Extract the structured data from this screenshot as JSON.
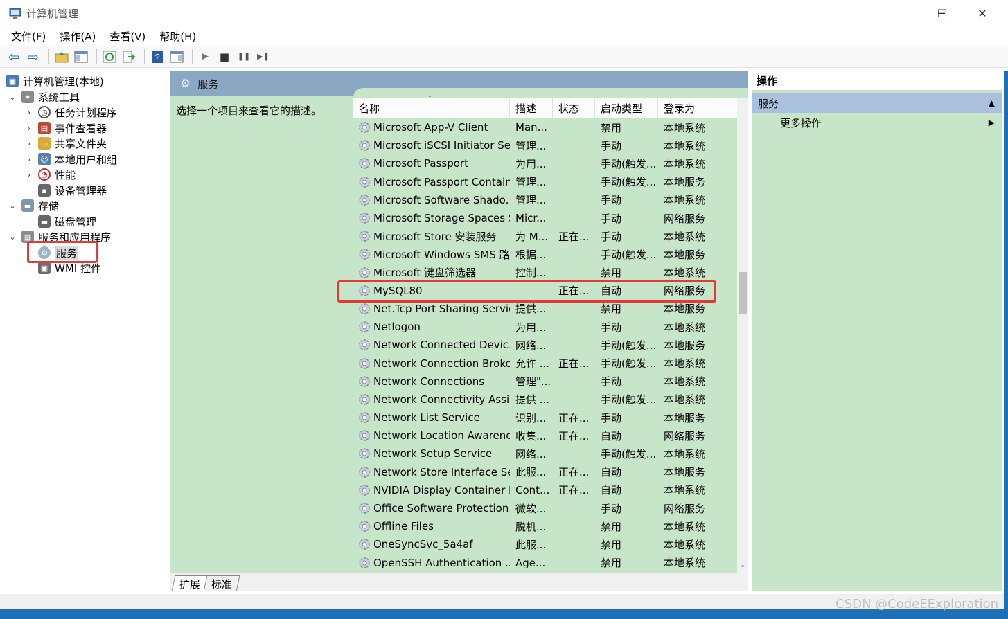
{
  "window": {
    "title": "计算机管理",
    "minimize": "─",
    "maximize": "☐",
    "close": "✕"
  },
  "menu": [
    "文件(F)",
    "操作(A)",
    "查看(V)",
    "帮助(H)"
  ],
  "toolbar": {
    "back": "⇦",
    "forward": "⇨",
    "play": "▶",
    "stop": "■",
    "pause": "❚❚",
    "restart": "▶❚"
  },
  "tree": {
    "root": "计算机管理(本地)",
    "system_tools": "系统工具",
    "task_scheduler": "任务计划程序",
    "event_viewer": "事件查看器",
    "shared_folders": "共享文件夹",
    "local_users": "本地用户和组",
    "performance": "性能",
    "device_manager": "设备管理器",
    "storage": "存储",
    "disk_management": "磁盘管理",
    "services_apps": "服务和应用程序",
    "services": "服务",
    "wmi": "WMI 控件"
  },
  "center": {
    "header": "服务",
    "description": "选择一个项目来查看它的描述。",
    "columns": [
      "名称",
      "描述",
      "状态",
      "启动类型",
      "登录为"
    ],
    "rows": [
      {
        "name": "Microsoft App-V Client",
        "desc": "Man...",
        "status": "",
        "startup": "禁用",
        "logon": "本地系统"
      },
      {
        "name": "Microsoft iSCSI Initiator Ser...",
        "desc": "管理...",
        "status": "",
        "startup": "手动",
        "logon": "本地系统"
      },
      {
        "name": "Microsoft Passport",
        "desc": "为用...",
        "status": "",
        "startup": "手动(触发...",
        "logon": "本地系统"
      },
      {
        "name": "Microsoft Passport Container",
        "desc": "管理...",
        "status": "",
        "startup": "手动(触发...",
        "logon": "本地服务"
      },
      {
        "name": "Microsoft Software Shado...",
        "desc": "管理...",
        "status": "",
        "startup": "手动",
        "logon": "本地系统"
      },
      {
        "name": "Microsoft Storage Spaces S...",
        "desc": "Micr...",
        "status": "",
        "startup": "手动",
        "logon": "网络服务"
      },
      {
        "name": "Microsoft Store 安装服务",
        "desc": "为 M...",
        "status": "正在...",
        "startup": "手动",
        "logon": "本地系统"
      },
      {
        "name": "Microsoft Windows SMS 路...",
        "desc": "根据...",
        "status": "",
        "startup": "手动(触发...",
        "logon": "本地服务"
      },
      {
        "name": "Microsoft 键盘筛选器",
        "desc": "控制...",
        "status": "",
        "startup": "禁用",
        "logon": "本地系统"
      },
      {
        "name": "MySQL80",
        "desc": "",
        "status": "正在...",
        "startup": "自动",
        "logon": "网络服务"
      },
      {
        "name": "Net.Tcp Port Sharing Service",
        "desc": "提供...",
        "status": "",
        "startup": "禁用",
        "logon": "本地服务"
      },
      {
        "name": "Netlogon",
        "desc": "为用...",
        "status": "",
        "startup": "手动",
        "logon": "本地系统"
      },
      {
        "name": "Network Connected Devic...",
        "desc": "网络...",
        "status": "",
        "startup": "手动(触发...",
        "logon": "本地服务"
      },
      {
        "name": "Network Connection Broker",
        "desc": "允许 ...",
        "status": "正在...",
        "startup": "手动(触发...",
        "logon": "本地系统"
      },
      {
        "name": "Network Connections",
        "desc": "管理\"...",
        "status": "",
        "startup": "手动",
        "logon": "本地系统"
      },
      {
        "name": "Network Connectivity Assis...",
        "desc": "提供 ...",
        "status": "",
        "startup": "手动(触发...",
        "logon": "本地系统"
      },
      {
        "name": "Network List Service",
        "desc": "识别...",
        "status": "正在...",
        "startup": "手动",
        "logon": "本地服务"
      },
      {
        "name": "Network Location Awarene...",
        "desc": "收集...",
        "status": "正在...",
        "startup": "自动",
        "logon": "网络服务"
      },
      {
        "name": "Network Setup Service",
        "desc": "网络...",
        "status": "",
        "startup": "手动(触发...",
        "logon": "本地系统"
      },
      {
        "name": "Network Store Interface Se...",
        "desc": "此服...",
        "status": "正在...",
        "startup": "自动",
        "logon": "本地服务"
      },
      {
        "name": "NVIDIA Display Container LS",
        "desc": "Cont...",
        "status": "正在...",
        "startup": "自动",
        "logon": "本地系统"
      },
      {
        "name": "Office Software Protection ...",
        "desc": "微软...",
        "status": "",
        "startup": "手动",
        "logon": "网络服务"
      },
      {
        "name": "Offline Files",
        "desc": "脱机...",
        "status": "",
        "startup": "禁用",
        "logon": "本地系统"
      },
      {
        "name": "OneSyncSvc_5a4af",
        "desc": "此服...",
        "status": "",
        "startup": "禁用",
        "logon": "本地系统"
      },
      {
        "name": "OpenSSH Authentication ...",
        "desc": "Age...",
        "status": "",
        "startup": "禁用",
        "logon": "本地系统"
      }
    ],
    "tabs": [
      "扩展",
      "标准"
    ]
  },
  "actions": {
    "header": "操作",
    "section": "服务",
    "more": "更多操作"
  },
  "watermark": "CSDN @CodeEExploration",
  "colors": {
    "pane_bg": "#c7e6c9",
    "header_blue": "#8aa8c4",
    "highlight_red": "#e53935",
    "taskbar_blue": "#1e6fb3"
  }
}
